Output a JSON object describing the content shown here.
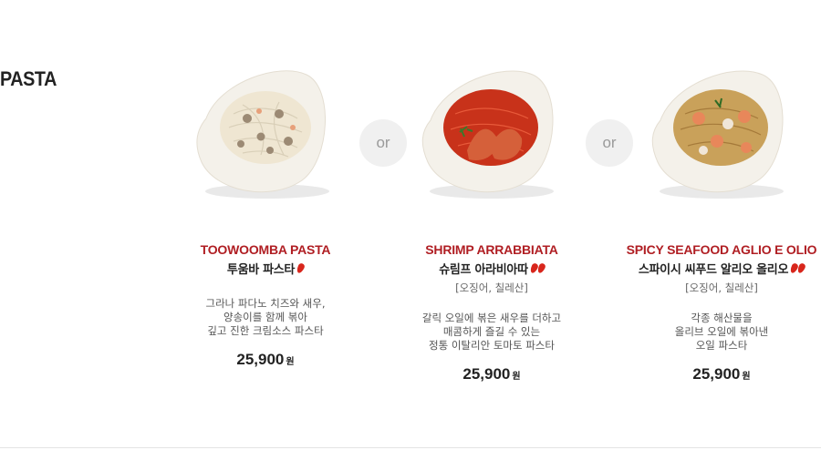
{
  "section": {
    "title": "PASTA"
  },
  "separator": "or",
  "menu": [
    {
      "name_en": "TOOWOOMBA PASTA",
      "name_kr": "투움바 파스타",
      "spicy_level": 1,
      "sub": "",
      "desc": [
        "그라나 파다노 치즈와 새우,",
        "양송이를 함께 볶아",
        "깊고 진한 크림소스 파스타"
      ],
      "price": "25,900",
      "currency": "원",
      "sauce_color": "#efe6d2"
    },
    {
      "name_en": "SHRIMP ARRABBIATA",
      "name_kr": "슈림프 아라비아따",
      "spicy_level": 2,
      "sub": "[오징어, 칠레산]",
      "desc": [
        "갈릭 오일에 볶은 새우를 더하고",
        "매콤하게 즐길 수 있는",
        "정통 이탈리안 토마토 파스타"
      ],
      "price": "25,900",
      "currency": "원",
      "sauce_color": "#c8321a"
    },
    {
      "name_en": "SPICY SEAFOOD AGLIO E OLIO",
      "name_kr": "스파이시 씨푸드 알리오 올리오",
      "spicy_level": 2,
      "sub": "[오징어, 칠레산]",
      "desc": [
        "각종 해산물을",
        "올리브 오일에 볶아낸",
        "오일 파스타"
      ],
      "price": "25,900",
      "currency": "원",
      "sauce_color": "#c9a15a"
    }
  ]
}
